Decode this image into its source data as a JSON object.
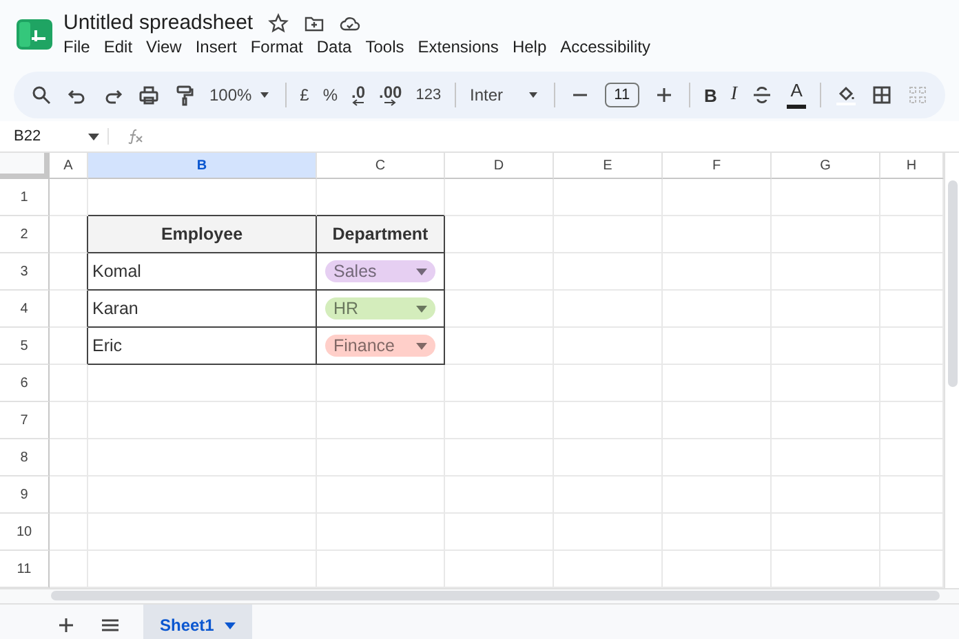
{
  "app": {
    "title": "Untitled spreadsheet",
    "menu": [
      "File",
      "Edit",
      "View",
      "Insert",
      "Format",
      "Data",
      "Tools",
      "Extensions",
      "Help",
      "Accessibility"
    ]
  },
  "toolbar": {
    "zoom": "100%",
    "currency": "£",
    "percent": "%",
    "decrease_decimals": ".0",
    "increase_decimals": ".00",
    "number_format": "123",
    "font": "Inter",
    "font_size": "11",
    "bold": "B",
    "italic": "I",
    "text_color": "A"
  },
  "formula_bar": {
    "cell_reference": "B22"
  },
  "columns": [
    {
      "label": "A",
      "selected": false
    },
    {
      "label": "B",
      "selected": true
    },
    {
      "label": "C",
      "selected": false
    },
    {
      "label": "D",
      "selected": false
    },
    {
      "label": "E",
      "selected": false
    },
    {
      "label": "F",
      "selected": false
    },
    {
      "label": "G",
      "selected": false
    },
    {
      "label": "H",
      "selected": false
    }
  ],
  "rows": [
    "1",
    "2",
    "3",
    "4",
    "5",
    "6",
    "7",
    "8",
    "9",
    "10",
    "11"
  ],
  "table": {
    "headers": [
      "Employee",
      "Department"
    ],
    "rows": [
      {
        "employee": "Komal",
        "department": "Sales",
        "color": "#e6cff2"
      },
      {
        "employee": "Karan",
        "department": "HR",
        "color": "#d4edbc"
      },
      {
        "employee": "Eric",
        "department": "Finance",
        "color": "#ffcfc9"
      }
    ]
  },
  "sheet_tabs": [
    {
      "label": "Sheet1",
      "selected": true
    }
  ]
}
